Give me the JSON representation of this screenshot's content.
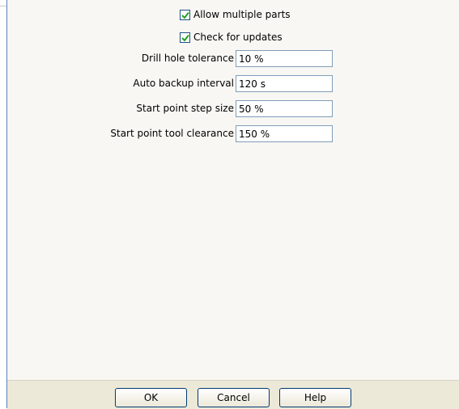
{
  "options": {
    "checkboxes": [
      {
        "label": "Allow multiple parts",
        "checked": true
      },
      {
        "label": "Check for updates",
        "checked": true
      }
    ],
    "fields": [
      {
        "label": "Drill hole tolerance",
        "value": "10 %"
      },
      {
        "label": "Auto backup interval",
        "value": "120 s"
      },
      {
        "label": "Start point step size",
        "value": "50 %"
      },
      {
        "label": "Start point tool clearance",
        "value": "150 %"
      }
    ]
  },
  "buttons": {
    "ok": "OK",
    "cancel": "Cancel",
    "help": "Help"
  },
  "colors": {
    "checkmark": "#21a121",
    "panel_border": "#5b7fbd"
  }
}
